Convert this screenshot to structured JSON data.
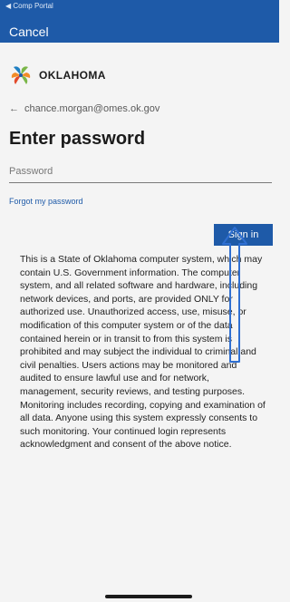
{
  "status_bar": {
    "back_app": "◀ Comp Portal"
  },
  "header": {
    "cancel_label": "Cancel"
  },
  "brand": {
    "name": "OKLAHOMA"
  },
  "account": {
    "back_arrow": "←",
    "email": "chance.morgan@omes.ok.gov"
  },
  "page": {
    "title": "Enter password"
  },
  "password_field": {
    "placeholder": "Password",
    "value": ""
  },
  "links": {
    "forgot": "Forgot my password"
  },
  "actions": {
    "sign_in": "Sign in"
  },
  "notice": {
    "text": "This is a State of Oklahoma computer system, which may contain U.S. Government information. The computer system, and all related software and hardware, including network devices, and ports, are provided ONLY for authorized use. Unauthorized access, use, misuse, or modification of this computer system or of the data contained herein or in transit to from this system is prohibited and may subject the individual to criminal and civil penalties. Users actions may be monitored and audited to ensure lawful use and for network, management, security reviews, and testing purposes. Monitoring includes recording, copying and examination of all data. Anyone using this system expressly consents to such monitoring. Your continued login represents acknowledgment and consent of the above notice."
  },
  "icons": {
    "logo": "oklahoma-logo-icon",
    "arrow": "up-arrow-annotation-icon",
    "back": "back-arrow-icon"
  },
  "colors": {
    "accent": "#1e5aa8",
    "background": "#f4f4f4",
    "arrow": "#2f6fd1"
  }
}
